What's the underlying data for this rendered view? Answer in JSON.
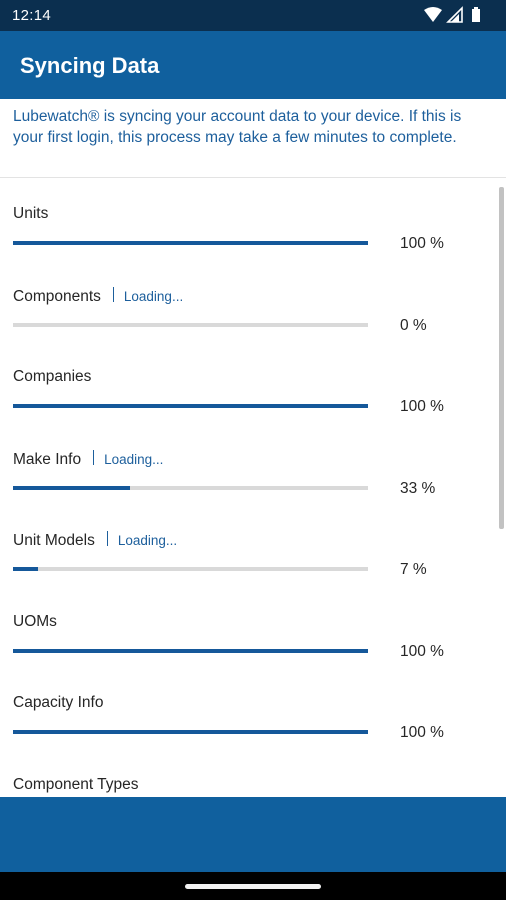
{
  "status_bar": {
    "time": "12:14"
  },
  "app_bar": {
    "title": "Syncing Data"
  },
  "intro_text": "Lubewatch® is syncing your account data to your device. If this is your first login, this process may take a few minutes to complete.",
  "colors": {
    "primary": "#10609e",
    "progress": "#15589a",
    "track": "#d9d9d9",
    "status_bar": "#0b2f4f"
  },
  "sync_items": [
    {
      "name": "Units",
      "status": "",
      "progress": 1.0,
      "percent_label": "100 %"
    },
    {
      "name": "Components",
      "status": "Loading...",
      "progress": 0.0,
      "percent_label": "0 %"
    },
    {
      "name": "Companies",
      "status": "",
      "progress": 1.0,
      "percent_label": "100 %"
    },
    {
      "name": "Make Info",
      "status": "Loading...",
      "progress": 0.33,
      "percent_label": "33 %"
    },
    {
      "name": "Unit Models",
      "status": "Loading...",
      "progress": 0.07,
      "percent_label": "7 %"
    },
    {
      "name": "UOMs",
      "status": "",
      "progress": 1.0,
      "percent_label": "100 %"
    },
    {
      "name": "Capacity Info",
      "status": "",
      "progress": 1.0,
      "percent_label": "100 %"
    },
    {
      "name": "Component Types",
      "status": "",
      "progress": 0.0,
      "percent_label": ""
    }
  ]
}
